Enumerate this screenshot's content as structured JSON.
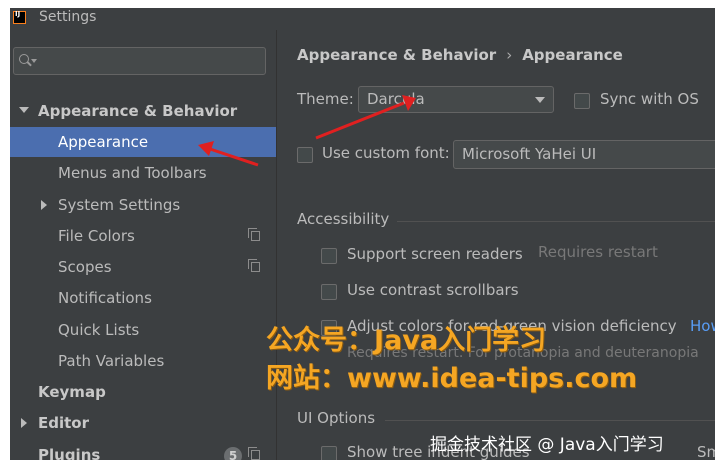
{
  "window": {
    "title": "Settings"
  },
  "search": {
    "placeholder": ""
  },
  "sidebar": {
    "items": [
      {
        "label": "Appearance & Behavior"
      },
      {
        "label": "Appearance"
      },
      {
        "label": "Menus and Toolbars"
      },
      {
        "label": "System Settings"
      },
      {
        "label": "File Colors"
      },
      {
        "label": "Scopes"
      },
      {
        "label": "Notifications"
      },
      {
        "label": "Quick Lists"
      },
      {
        "label": "Path Variables"
      },
      {
        "label": "Keymap"
      },
      {
        "label": "Editor"
      },
      {
        "label": "Plugins",
        "badge": "5"
      }
    ]
  },
  "main": {
    "breadcrumb": [
      "Appearance & Behavior",
      "›",
      "Appearance"
    ],
    "theme": {
      "label": "Theme:",
      "value": "Darcula"
    },
    "sync_os": {
      "label": "Sync with OS",
      "checked": false
    },
    "custom_font": {
      "label": "Use custom font:",
      "checked": false,
      "value": "Microsoft YaHei UI"
    },
    "accessibility": {
      "heading": "Accessibility",
      "screen_readers": {
        "label": "Support screen readers",
        "hint": "Requires restart"
      },
      "contrast_scrollbars": {
        "label": "Use contrast scrollbars"
      },
      "color_deficiency": {
        "label": "Adjust colors for red-green vision deficiency",
        "link": "How",
        "hint": "Requires restart. For protanopia and deuteranopia"
      }
    },
    "ui_options": {
      "heading": "UI Options",
      "tree_indent": {
        "label": "Show tree indent guides"
      },
      "small": "Sm"
    }
  },
  "watermark": {
    "line1": "公众号：Java入门学习",
    "line2": "网站：www.idea-tips.com",
    "footer": "掘金技术社区 @ Java入门学习"
  },
  "colors": {
    "accent": "#4b6eaf",
    "background": "#3c3f41",
    "annotation": "#e02020",
    "watermark": "#f5a623"
  }
}
